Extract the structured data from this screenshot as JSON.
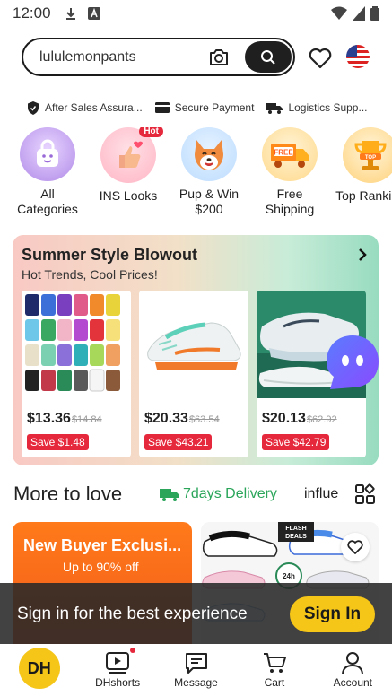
{
  "status": {
    "time": "12:00"
  },
  "search": {
    "query": "lululemonpants"
  },
  "trust": [
    {
      "label": "After Sales Assura...",
      "icon": "shield-icon"
    },
    {
      "label": "Secure Payment",
      "icon": "card-icon"
    },
    {
      "label": "Logistics Supp...",
      "icon": "truck-icon"
    }
  ],
  "categories": [
    {
      "label": "All Categories",
      "icon": "bag-icon"
    },
    {
      "label": "INS Looks",
      "icon": "thumbs-up-icon",
      "badge": "Hot"
    },
    {
      "label": "Pup & Win $200",
      "icon": "dog-icon"
    },
    {
      "label": "Free Shipping",
      "icon": "free-truck-icon"
    },
    {
      "label": "Top Ranking",
      "icon": "trophy-icon"
    }
  ],
  "summer": {
    "title": "Summer Style Blowout",
    "subtitle": "Hot Trends, Cool Prices!",
    "products": [
      {
        "price": "$13.36",
        "old": "$14.84",
        "save": "Save $1.48"
      },
      {
        "price": "$20.33",
        "old": "$63.54",
        "save": "Save $43.21"
      },
      {
        "price": "$20.13",
        "old": "$62.92",
        "save": "Save $42.79"
      }
    ]
  },
  "more": {
    "title": "More to love",
    "delivery": "7days Delivery",
    "influ": "influe"
  },
  "promo": {
    "title": "New Buyer Exclusi...",
    "subtitle": "Up to 90% off"
  },
  "signin": {
    "text": "Sign in for the best experience",
    "button": "Sign In"
  },
  "nav": [
    {
      "label": "DH"
    },
    {
      "label": "DHshorts"
    },
    {
      "label": "Message"
    },
    {
      "label": "Cart"
    },
    {
      "label": "Account"
    }
  ],
  "colors": {
    "accent": "#f5c518",
    "sale": "#e6283c",
    "delivery": "#2aa55a"
  }
}
